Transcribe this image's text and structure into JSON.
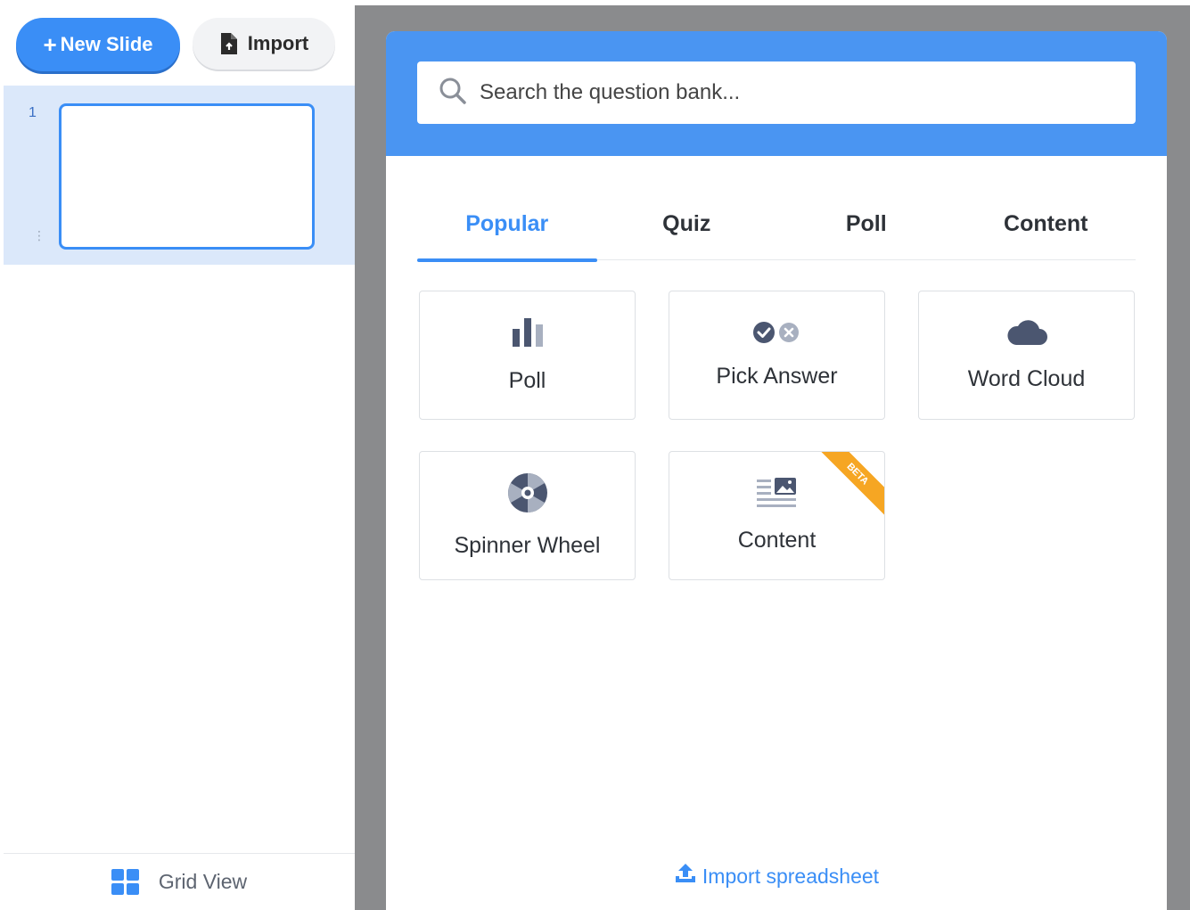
{
  "sidebar": {
    "new_slide_label": "New Slide",
    "new_slide_icon": "plus-icon",
    "import_label": "Import",
    "import_icon": "file-upload-icon",
    "slides": [
      {
        "number": "1"
      }
    ],
    "grid_view_label": "Grid View",
    "grid_view_icon": "grid-icon"
  },
  "modal": {
    "search": {
      "placeholder": "Search the question bank...",
      "icon": "search-icon"
    },
    "tabs": [
      {
        "label": "Popular",
        "active": true
      },
      {
        "label": "Quiz",
        "active": false
      },
      {
        "label": "Poll",
        "active": false
      },
      {
        "label": "Content",
        "active": false
      }
    ],
    "cards": [
      {
        "label": "Poll",
        "icon": "bar-chart-icon"
      },
      {
        "label": "Pick Answer",
        "icon": "check-x-icon"
      },
      {
        "label": "Word Cloud",
        "icon": "cloud-icon"
      },
      {
        "label": "Spinner Wheel",
        "icon": "spinner-wheel-icon"
      },
      {
        "label": "Content",
        "icon": "content-icon",
        "badge": "BETA"
      }
    ],
    "import_spreadsheet_label": "Import spreadsheet",
    "import_spreadsheet_icon": "upload-icon"
  },
  "colors": {
    "accent": "#3a8ef6",
    "header_blue": "#4a95f2",
    "selected_row": "#dbe8fa",
    "backdrop": "#8a8b8d",
    "beta_badge": "#f6a623",
    "icon_dark": "#4b5670"
  }
}
